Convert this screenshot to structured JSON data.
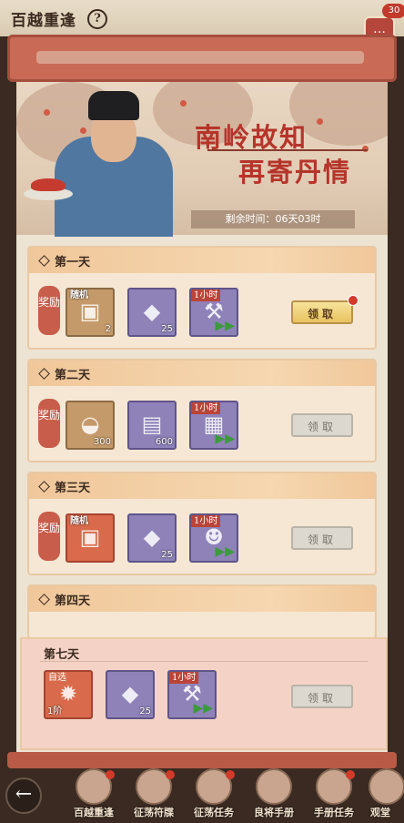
{
  "header": {
    "title": "百越重逢",
    "help": "?",
    "chat_badge": "30"
  },
  "banner": {
    "headline_line1": "南岭故知",
    "headline_line2": "再寄丹情",
    "timer": "剩余时间：06天03时"
  },
  "days": [
    {
      "label": "第一天",
      "reward_tag": "奖励",
      "items": [
        {
          "tag": "随机",
          "count": "2",
          "icon": "chest-icon",
          "kind": "gold"
        },
        {
          "tag": "",
          "count": "25",
          "icon": "stone-icon",
          "kind": "purple"
        },
        {
          "tag": "1小时",
          "count": "",
          "icon": "hammer-speedup-icon",
          "kind": "purple"
        }
      ],
      "button": "领取",
      "button_state": "active"
    },
    {
      "label": "第二天",
      "reward_tag": "奖励",
      "items": [
        {
          "tag": "",
          "count": "300",
          "icon": "gold-ingot-icon",
          "kind": "gold"
        },
        {
          "tag": "",
          "count": "600",
          "icon": "book-icon",
          "kind": "purple"
        },
        {
          "tag": "1小时",
          "count": "",
          "icon": "scroll-speedup-icon",
          "kind": "purple"
        }
      ],
      "button": "领取",
      "button_state": "disabled"
    },
    {
      "label": "第三天",
      "reward_tag": "奖励",
      "items": [
        {
          "tag": "随机",
          "count": "",
          "icon": "chest-icon",
          "kind": "red"
        },
        {
          "tag": "",
          "count": "25",
          "icon": "stone-icon",
          "kind": "purple"
        },
        {
          "tag": "1小时",
          "count": "",
          "icon": "soldier-speedup-icon",
          "kind": "purple"
        }
      ],
      "button": "领取",
      "button_state": "disabled"
    },
    {
      "label": "第四天"
    }
  ],
  "day7": {
    "label": "第七天",
    "items": [
      {
        "tag": "自选",
        "count": "1阶",
        "icon": "gem-icon",
        "kind": "red"
      },
      {
        "tag": "",
        "count": "25",
        "icon": "stone-icon",
        "kind": "purple"
      },
      {
        "tag": "1小时",
        "count": "",
        "icon": "hammer-speedup-icon",
        "kind": "purple"
      }
    ],
    "button": "领取",
    "button_state": "disabled"
  },
  "bottom_nav": [
    {
      "label": "百越重逢",
      "icon": "event-icon"
    },
    {
      "label": "征荡符牒",
      "icon": "pass-icon"
    },
    {
      "label": "征荡任务",
      "icon": "task-icon"
    },
    {
      "label": "良将手册",
      "icon": "manual-icon"
    },
    {
      "label": "手册任务",
      "icon": "manual-task-icon"
    },
    {
      "label": "观堂",
      "icon": "hall-icon"
    }
  ],
  "colors": {
    "accent_red": "#b6342a",
    "card_bg": "#f5e7d4",
    "button_active": "#e8c25f"
  }
}
